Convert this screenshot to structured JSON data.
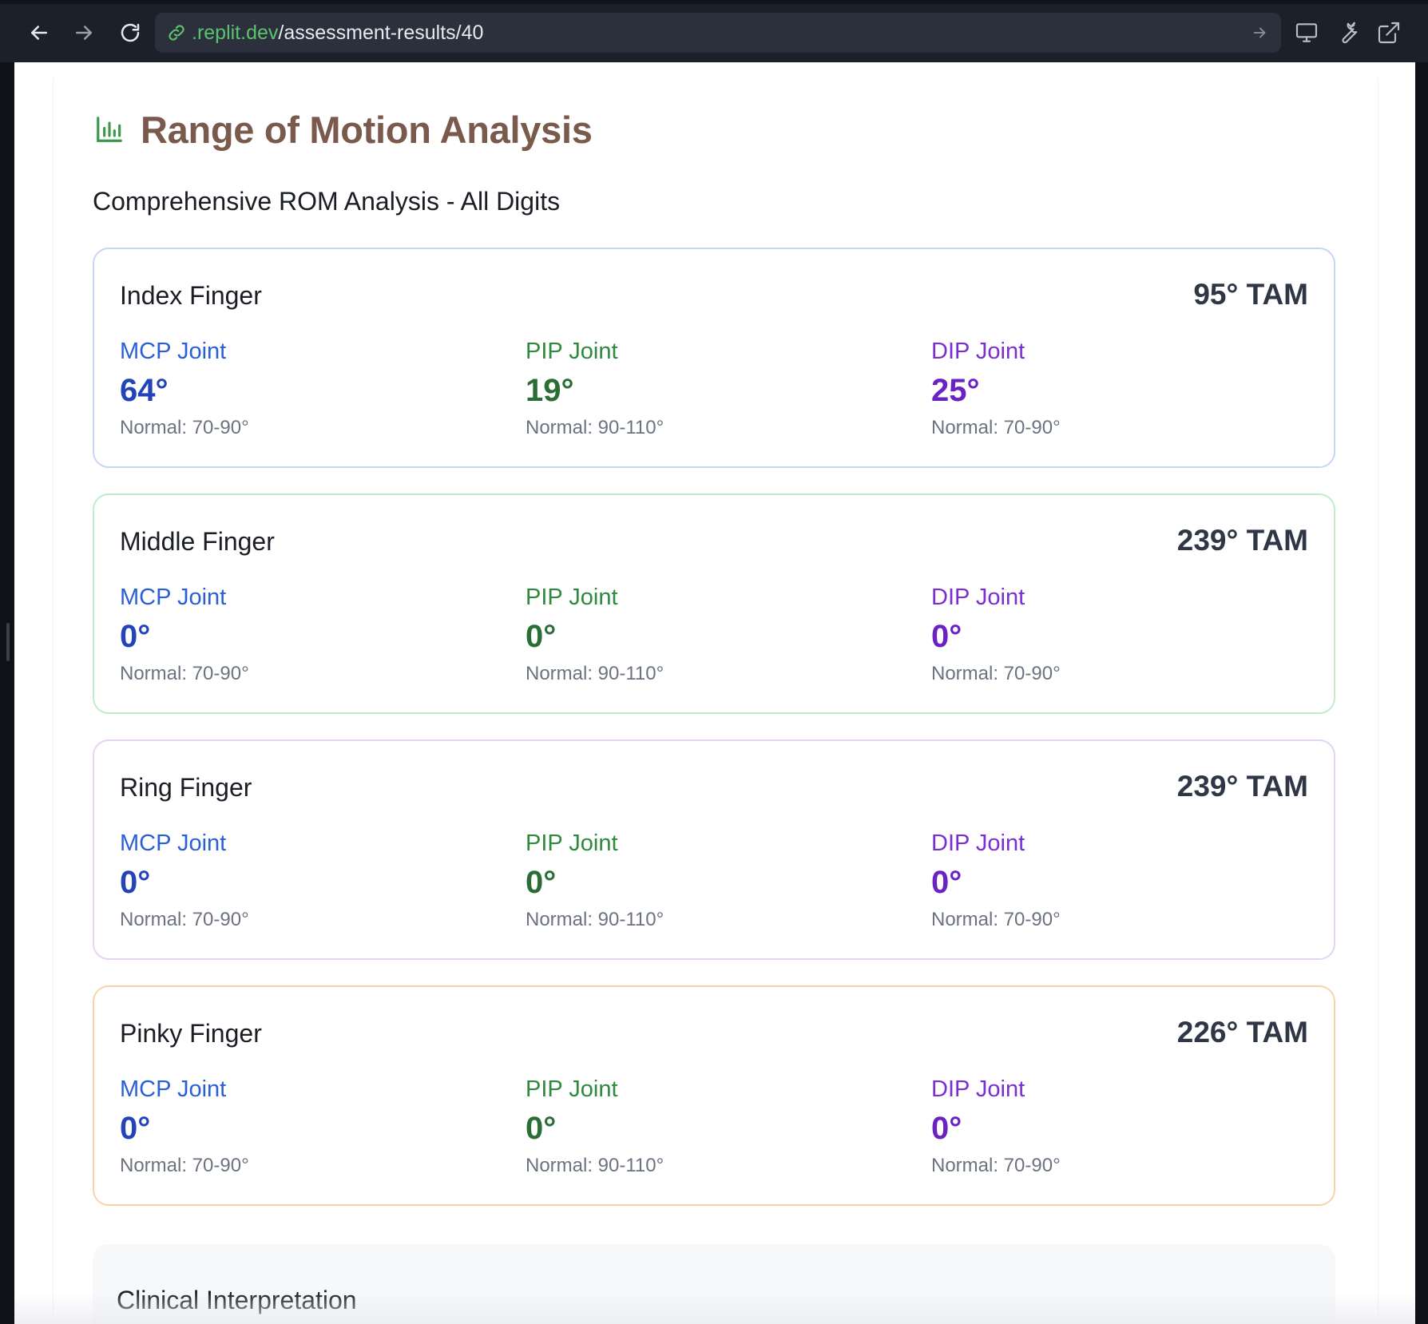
{
  "browser": {
    "url_domain": ".replit.dev",
    "url_path": "/assessment-results/40",
    "icons": {
      "back": "arrow-left-icon",
      "forward": "arrow-right-icon",
      "reload": "reload-icon",
      "link": "link-icon",
      "go": "arrow-right-icon",
      "devices": "monitor-icon",
      "tools": "wrench-icon",
      "open_external": "external-link-icon"
    }
  },
  "section": {
    "icon": "bar-chart-icon",
    "title": "Range of Motion Analysis",
    "subtitle": "Comprehensive ROM Analysis - All Digits"
  },
  "colors": {
    "title": "#7a5a4c",
    "icon": "#3a9a4a",
    "mcp": "#2b5fd6",
    "pip": "#2f8a3e",
    "dip": "#7a2fd0",
    "index_border": "#c6d5f6",
    "middle_border": "#bfeccd",
    "ring_border": "#e6d3f4",
    "pinky_border": "#f6d4a8"
  },
  "fingers": [
    {
      "name": "Index Finger",
      "tam": "95° TAM",
      "joints": [
        {
          "label": "MCP Joint",
          "value": "64°",
          "normal": "Normal: 70-90°"
        },
        {
          "label": "PIP Joint",
          "value": "19°",
          "normal": "Normal: 90-110°"
        },
        {
          "label": "DIP Joint",
          "value": "25°",
          "normal": "Normal: 70-90°"
        }
      ]
    },
    {
      "name": "Middle Finger",
      "tam": "239° TAM",
      "joints": [
        {
          "label": "MCP Joint",
          "value": "0°",
          "normal": "Normal: 70-90°"
        },
        {
          "label": "PIP Joint",
          "value": "0°",
          "normal": "Normal: 90-110°"
        },
        {
          "label": "DIP Joint",
          "value": "0°",
          "normal": "Normal: 70-90°"
        }
      ]
    },
    {
      "name": "Ring Finger",
      "tam": "239° TAM",
      "joints": [
        {
          "label": "MCP Joint",
          "value": "0°",
          "normal": "Normal: 70-90°"
        },
        {
          "label": "PIP Joint",
          "value": "0°",
          "normal": "Normal: 90-110°"
        },
        {
          "label": "DIP Joint",
          "value": "0°",
          "normal": "Normal: 70-90°"
        }
      ]
    },
    {
      "name": "Pinky Finger",
      "tam": "226° TAM",
      "joints": [
        {
          "label": "MCP Joint",
          "value": "0°",
          "normal": "Normal: 70-90°"
        },
        {
          "label": "PIP Joint",
          "value": "0°",
          "normal": "Normal: 90-110°"
        },
        {
          "label": "DIP Joint",
          "value": "0°",
          "normal": "Normal: 70-90°"
        }
      ]
    }
  ],
  "interpretation": {
    "title": "Clinical Interpretation"
  }
}
